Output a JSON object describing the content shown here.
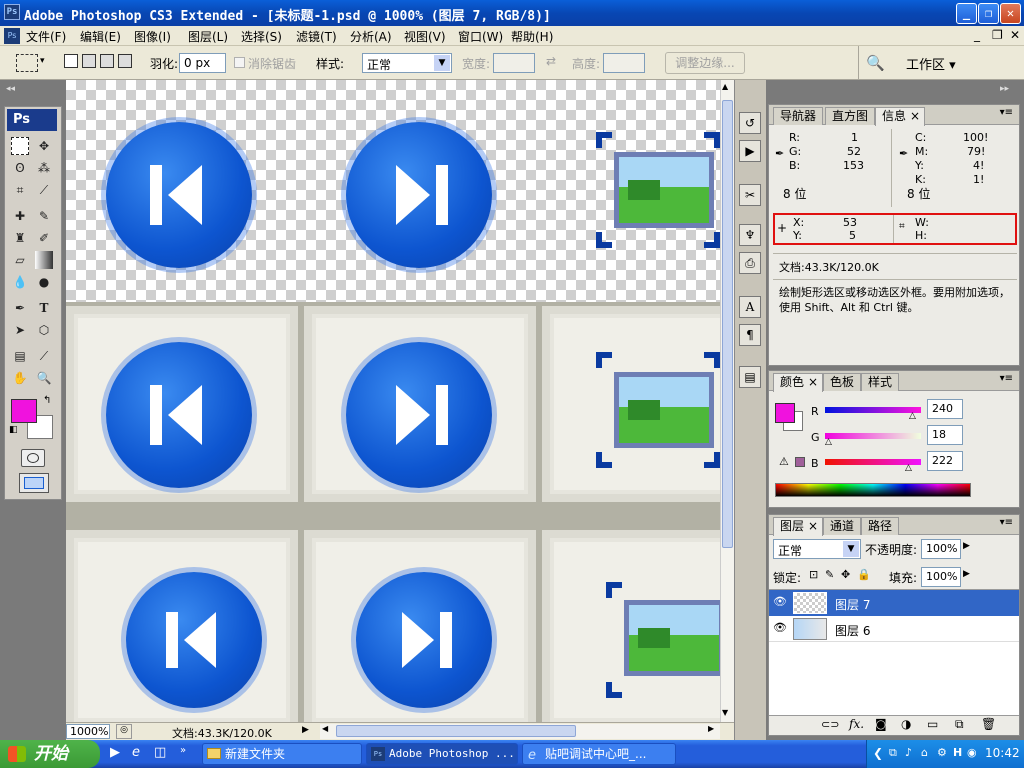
{
  "titlebar": {
    "app_icon": "Ps",
    "title": "Adobe Photoshop CS3 Extended - [未标题-1.psd @ 1000% (图层 7, RGB/8)]"
  },
  "menu": [
    "文件(F)",
    "编辑(E)",
    "图像(I)",
    "图层(L)",
    "选择(S)",
    "滤镜(T)",
    "分析(A)",
    "视图(V)",
    "窗口(W)",
    "帮助(H)"
  ],
  "options": {
    "feather_label": "羽化:",
    "feather_value": "0 px",
    "antialias_label": "消除锯齿",
    "style_label": "样式:",
    "style_value": "正常",
    "width_label": "宽度:",
    "height_label": "高度:",
    "refine_edge": "调整边缘...",
    "workspace": "工作区"
  },
  "toolbox": {
    "logo": "Ps",
    "fg_color": "#f012de",
    "bg_color": "#ffffff"
  },
  "info_panel": {
    "tabs": [
      "导航器",
      "直方图",
      "信息"
    ],
    "rgb": {
      "R_label": "R:",
      "R": "1",
      "G_label": "G:",
      "G": "52",
      "B_label": "B:",
      "B": "153",
      "bits": "8 位"
    },
    "cmyk": {
      "C_label": "C:",
      "C": "100!",
      "M_label": "M:",
      "M": "79!",
      "Y_label": "Y:",
      "Y": "4!",
      "K_label": "K:",
      "K": "1!",
      "bits": "8 位"
    },
    "xy": {
      "X_label": "X:",
      "X": "53",
      "Y_label": "Y:",
      "Y": "5",
      "W_label": "W:",
      "H_label": "H:"
    },
    "doc": "文档:43.3K/120.0K",
    "hint": "绘制矩形选区或移动选区外框。要用附加选项，使用 Shift、Alt 和 Ctrl 键。"
  },
  "color_panel": {
    "tabs": [
      "颜色",
      "色板",
      "样式"
    ],
    "R_label": "R",
    "R": "240",
    "G_label": "G",
    "G": "18",
    "B_label": "B",
    "B": "222",
    "fg": "#f012de"
  },
  "layers_panel": {
    "tabs": [
      "图层",
      "通道",
      "路径"
    ],
    "blend": "正常",
    "opacity_label": "不透明度:",
    "opacity": "100%",
    "lock_label": "锁定:",
    "fill_label": "填充:",
    "fill": "100%",
    "layers": [
      {
        "name": "图层 7",
        "selected": true
      },
      {
        "name": "图层 6",
        "selected": false
      }
    ]
  },
  "statusbar": {
    "zoom": "1000%",
    "doc": "文档:43.3K/120.0K"
  },
  "taskbar": {
    "start": "开始",
    "tasks": [
      "新建文件夹",
      "Adobe Photoshop ...",
      "贴吧调试中心吧_..."
    ],
    "clock": "10:42"
  }
}
